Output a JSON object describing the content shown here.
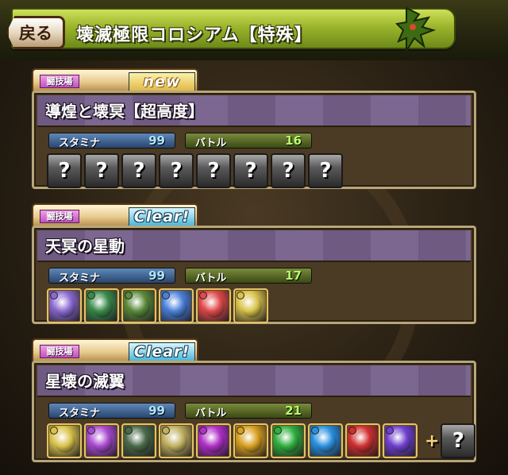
{
  "header": {
    "back_label": "戻る",
    "title": "壊滅極限コロシアム【特殊】",
    "icon": "dragon-icon"
  },
  "dungeons": [
    {
      "tag": "闘技場",
      "status": "new",
      "status_type": "new",
      "name": "導煌と壊冥【超高度】",
      "stamina_label": "スタミナ",
      "stamina": "99",
      "battle_label": "バトル",
      "battles": "16",
      "slots": [
        "?",
        "?",
        "?",
        "?",
        "?",
        "?",
        "?",
        "?"
      ]
    },
    {
      "tag": "闘技場",
      "status": "Clear!",
      "status_type": "clear",
      "name": "天冥の星動",
      "stamina_label": "スタミナ",
      "stamina": "99",
      "battle_label": "バトル",
      "battles": "17",
      "slots": [
        "monster",
        "monster",
        "monster",
        "monster",
        "monster",
        "monster"
      ]
    },
    {
      "tag": "闘技場",
      "status": "Clear!",
      "status_type": "clear",
      "name": "星壊の滅翼",
      "stamina_label": "スタミナ",
      "stamina": "99",
      "battle_label": "バトル",
      "battles": "21",
      "slots": [
        "monster",
        "monster",
        "monster",
        "monster",
        "monster",
        "monster",
        "monster",
        "monster",
        "monster",
        "monster"
      ],
      "extra": "+?"
    }
  ],
  "colors": {
    "header_bar": "#9bb52c",
    "panel_border": "#b8a67a",
    "panel_name_bg": "#7b6790",
    "stamina_value": "#aee4ff",
    "battle_value": "#b8ff6a"
  },
  "monster_palette": {
    "dungeon_2": [
      "#8a6ad0",
      "#3a8a4a",
      "#5a8a3a",
      "#4a80d8",
      "#e04a4a",
      "#d8c24a"
    ],
    "dungeon_3": [
      "#d8c24a",
      "#a84ad0",
      "#4a6a4a",
      "#c0b060",
      "#b030c8",
      "#d8a020",
      "#30b040",
      "#2a90e0",
      "#d03030",
      "#7040d0"
    ]
  }
}
